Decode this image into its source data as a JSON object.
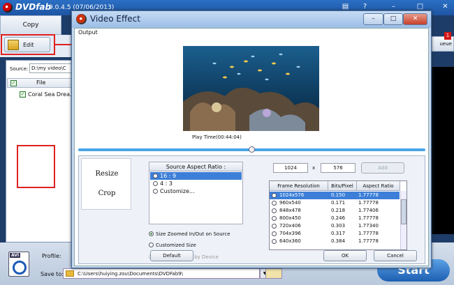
{
  "app": {
    "name": "DVDfab",
    "version": "9.0.4.5 (07/06/2013)"
  },
  "main": {
    "copy_tab": "Copy",
    "edit_button": "Edit",
    "source_label": "Source:",
    "source_value": "D:\\my video\\C",
    "file_column": "File",
    "file_item": "Coral Sea Drea...",
    "queue_label": "ueue",
    "queue_badge": "1",
    "profile_label": "Profile:",
    "save_to_label": "Save to:",
    "save_path": "C:\\Users\\huiying.zou\\Documents\\DVDFab9\\",
    "start_label": "Start",
    "avi_label": "AVI"
  },
  "dialog": {
    "title": "Video Effect",
    "output_label": "Output",
    "play_time": "Play Time(00:44:04)",
    "seek_progress": 0.5,
    "tabs": [
      "Resize",
      "Crop"
    ],
    "aspect": {
      "header": "Source Aspect Ratio :",
      "options": [
        "16 : 9",
        "4 : 3",
        "Customize..."
      ],
      "selected_index": 0
    },
    "size_options": [
      "Size Zoomed In/Out on Source",
      "Customized Size",
      "Size Supported by Device"
    ],
    "width": "1024",
    "height": "576",
    "x_label": "x",
    "add_button": "Add",
    "table": {
      "headers": [
        "Frame Resolution",
        "Bits/Pixel",
        "Aspect Ratio"
      ],
      "rows": [
        [
          "1024x576",
          "0.150",
          "1.77778"
        ],
        [
          "960x540",
          "0.171",
          "1.77778"
        ],
        [
          "848x478",
          "0.218",
          "1.77406"
        ],
        [
          "800x450",
          "0.246",
          "1.77778"
        ],
        [
          "720x406",
          "0.303",
          "1.77340"
        ],
        [
          "704x396",
          "0.317",
          "1.77778"
        ],
        [
          "640x360",
          "0.384",
          "1.77778"
        ]
      ],
      "selected_index": 0
    },
    "default_button": "Default",
    "ok_button": "OK",
    "cancel_button": "Cancel"
  }
}
